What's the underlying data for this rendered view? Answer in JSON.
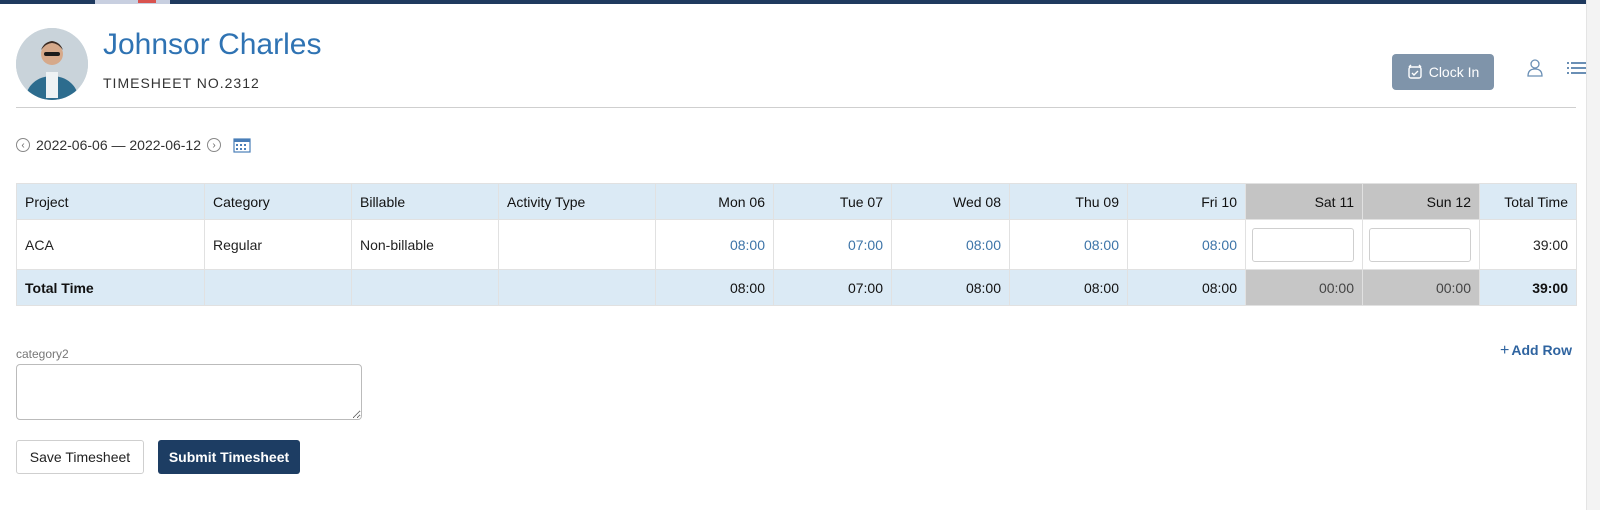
{
  "employee": {
    "name": "Johnsor Charles",
    "timesheet_no": "TIMESHEET NO.2312"
  },
  "header_actions": {
    "clock_in_label": "Clock In",
    "clock_in_icon": "alarm-clock-icon",
    "user_icon": "user-icon",
    "menu_icon": "list-icon"
  },
  "date_range": {
    "label": "2022-06-06 — 2022-06-12",
    "prev_icon": "chevron-left-icon",
    "next_icon": "chevron-right-icon",
    "calendar_icon": "calendar-icon"
  },
  "table": {
    "columns": [
      "Project",
      "Category",
      "Billable",
      "Activity Type",
      "Mon 06",
      "Tue 07",
      "Wed 08",
      "Thu 09",
      "Fri 10",
      "Sat 11",
      "Sun 12",
      "Total Time"
    ],
    "rows": [
      {
        "project": "ACA",
        "category": "Regular",
        "billable": "Non-billable",
        "activity_type": "",
        "days": [
          "08:00",
          "07:00",
          "08:00",
          "08:00",
          "08:00",
          "",
          ""
        ],
        "total": "39:00"
      }
    ],
    "footer": {
      "label": "Total Time",
      "days": [
        "08:00",
        "07:00",
        "08:00",
        "08:00",
        "08:00",
        "00:00",
        "00:00"
      ],
      "total": "39:00"
    }
  },
  "add_row_label": "Add Row",
  "category_field": {
    "label": "category2",
    "value": ""
  },
  "buttons": {
    "save": "Save Timesheet",
    "submit": "Submit Timesheet"
  },
  "colors": {
    "accent": "#2f73b3",
    "header_bg": "#dbeaf5",
    "weekend_bg": "#c4c4c4",
    "submit_bg": "#1d3d63",
    "clockin_bg": "#7f94aa"
  }
}
